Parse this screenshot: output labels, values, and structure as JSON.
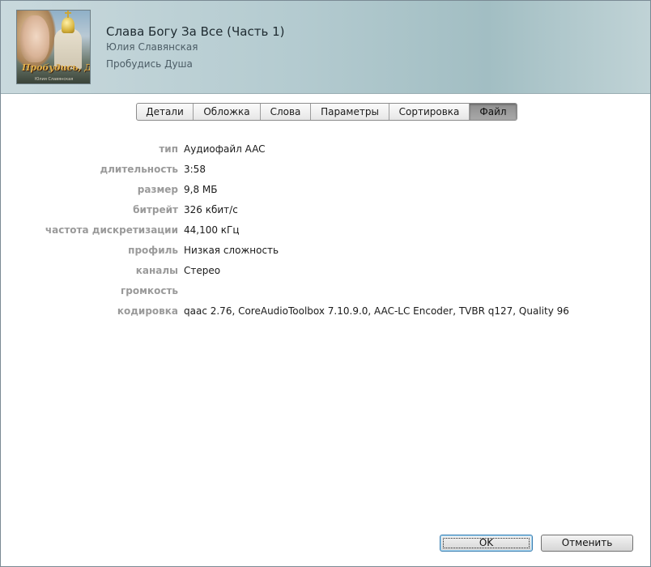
{
  "header": {
    "title": "Слава Богу За Все (Часть 1)",
    "artist": "Юлия Славянская",
    "album": "Пробудись Душа",
    "artwork": {
      "title_text": "Пробудись, Душа!",
      "subtitle_text": "Юлия Славянская"
    }
  },
  "tabs": [
    {
      "label": "Детали",
      "active": false
    },
    {
      "label": "Обложка",
      "active": false
    },
    {
      "label": "Слова",
      "active": false
    },
    {
      "label": "Параметры",
      "active": false
    },
    {
      "label": "Сортировка",
      "active": false
    },
    {
      "label": "Файл",
      "active": true
    }
  ],
  "file_info": [
    {
      "label": "тип",
      "value": "Аудиофайл AAC"
    },
    {
      "label": "длительность",
      "value": "3:58"
    },
    {
      "label": "размер",
      "value": "9,8 МБ"
    },
    {
      "label": "битрейт",
      "value": "326 кбит/с"
    },
    {
      "label": "частота дискретизации",
      "value": "44,100 кГц"
    },
    {
      "label": "профиль",
      "value": "Низкая сложность"
    },
    {
      "label": "каналы",
      "value": "Стерео"
    },
    {
      "label": "громкость",
      "value": ""
    },
    {
      "label": "кодировка",
      "value": "qaac 2.76, CoreAudioToolbox 7.10.9.0, AAC-LC Encoder, TVBR q127, Quality 96"
    }
  ],
  "buttons": {
    "ok_label": "OK",
    "cancel_label": "Отменить"
  }
}
